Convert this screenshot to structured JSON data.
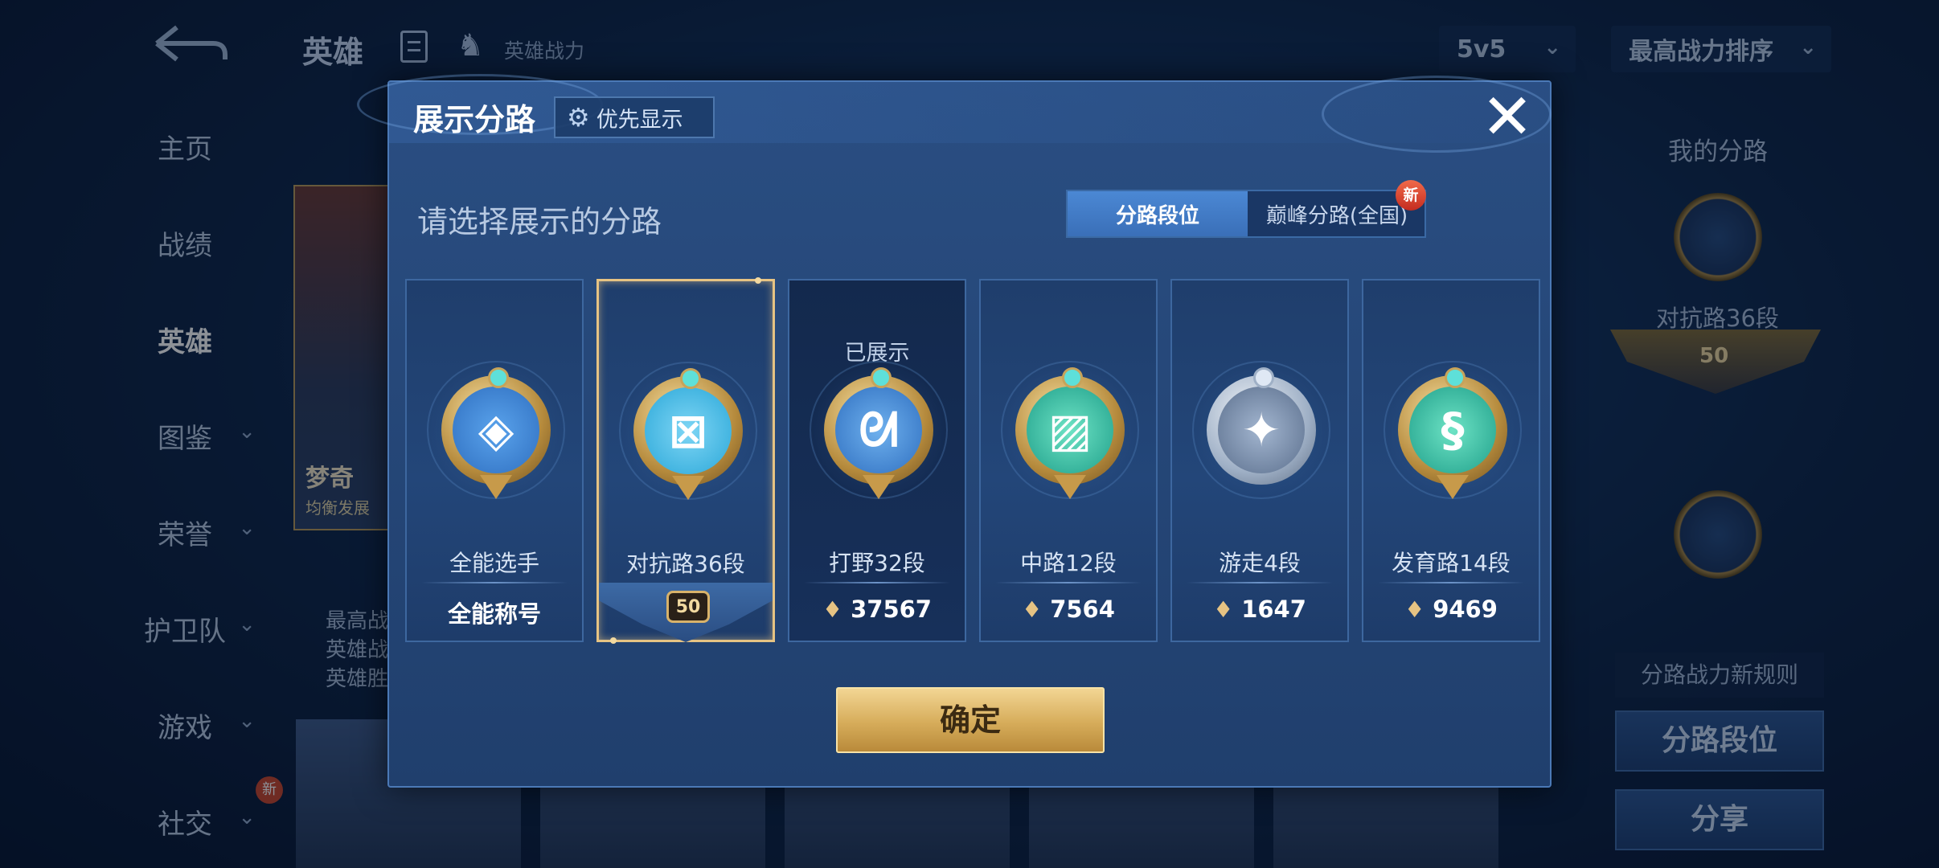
{
  "background": {
    "title": "英雄",
    "hero_power_label": "英雄战力",
    "mode_select": "5v5",
    "sort_select": "最高战力排序",
    "nav": [
      {
        "label": "主页"
      },
      {
        "label": "战绩"
      },
      {
        "label": "英雄"
      },
      {
        "label": "图鉴"
      },
      {
        "label": "荣誉"
      },
      {
        "label": "护卫队"
      },
      {
        "label": "游戏"
      },
      {
        "label": "社交"
      }
    ],
    "hero_card": {
      "name": "梦奇",
      "subtitle": "均衡发展",
      "stats": [
        "最高战",
        "英雄战",
        "英雄胜"
      ]
    },
    "social_new_tag": "新",
    "right_panel": {
      "title": "我的分路",
      "badge_label": "对抗路36段",
      "badge_level": "50",
      "rule_text": "分路战力新规则",
      "lane_rank_button": "分路段位",
      "share_button": "分享"
    }
  },
  "modal": {
    "title": "展示分路",
    "priority_button": "优先显示",
    "subtitle": "请选择展示的分路",
    "tabs": [
      {
        "label": "分路段位",
        "active": true
      },
      {
        "label": "巅峰分路(全国)",
        "active": false,
        "badge": "新"
      }
    ],
    "cards": [
      {
        "name": "全能选手",
        "value": "全能称号",
        "icon": "all-round-badge-icon",
        "core_color": "#2f6fc0",
        "glyph": "◈",
        "state": "normal"
      },
      {
        "name": "对抗路36段",
        "level": "50",
        "icon": "clash-lane-badge-icon",
        "core_color": "#2aa7d8",
        "glyph": "⊠",
        "state": "selected"
      },
      {
        "name": "打野32段",
        "value": "37567",
        "shown_label": "已展示",
        "icon": "jungle-badge-icon",
        "core_color": "#2f6fc0",
        "glyph": "ᘛ",
        "state": "shown"
      },
      {
        "name": "中路12段",
        "value": "7564",
        "icon": "mid-lane-badge-icon",
        "core_color": "#1f9f8a",
        "glyph": "▨",
        "state": "normal"
      },
      {
        "name": "游走4段",
        "value": "1647",
        "icon": "roam-badge-icon",
        "core_color": "#5b6f8d",
        "glyph": "✦",
        "state": "normal"
      },
      {
        "name": "发育路14段",
        "value": "9469",
        "icon": "farm-lane-badge-icon",
        "core_color": "#1f9f8a",
        "glyph": "§",
        "state": "normal"
      }
    ],
    "confirm_button": "确定"
  }
}
